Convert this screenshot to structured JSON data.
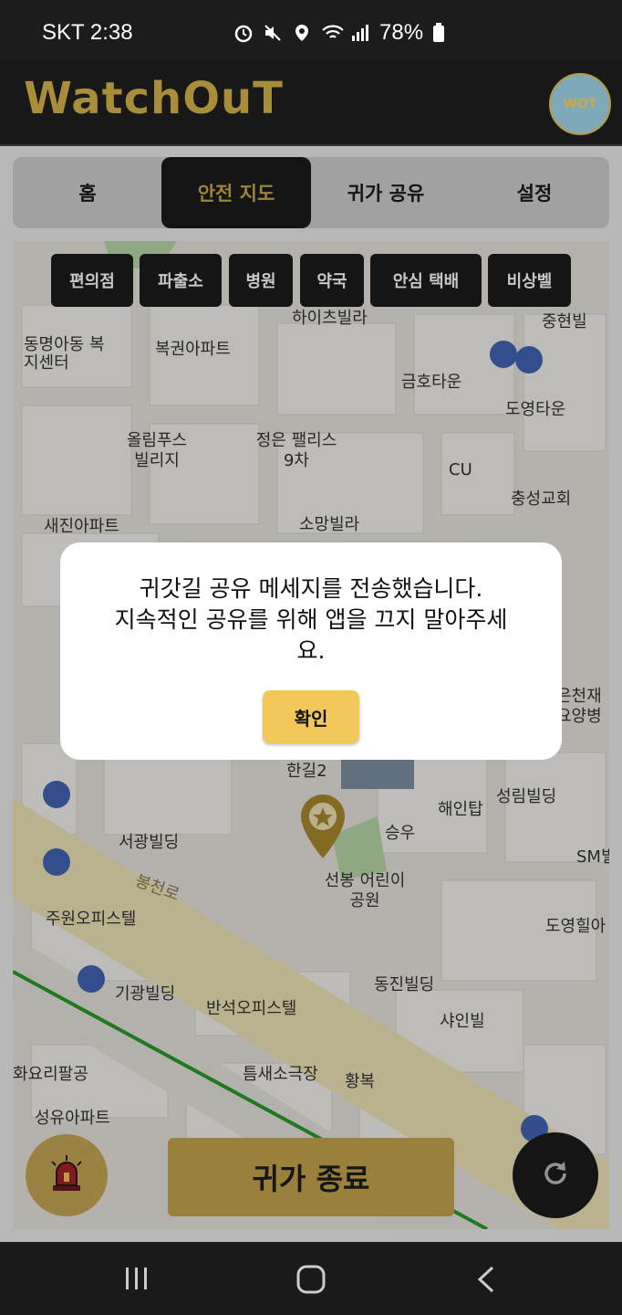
{
  "status_bar": {
    "carrier_time": "SKT 2:38",
    "battery": "78%"
  },
  "app": {
    "title": "WatchOuT",
    "avatar_text": "WOT"
  },
  "tabs": [
    {
      "label": "홈"
    },
    {
      "label": "안전 지도"
    },
    {
      "label": "귀가 공유"
    },
    {
      "label": "설정"
    }
  ],
  "filters": [
    "편의점",
    "파출소",
    "병원",
    "약국",
    "안심 택배",
    "비상벨"
  ],
  "map_labels": [
    "하이츠빌라",
    "중현빌",
    "동명아동 복지센터",
    "복권아파트",
    "금호타운",
    "도영타운",
    "올림푸스 빌리지",
    "정은 팰리스9차",
    "CU",
    "충성교회",
    "새진아파트",
    "소망빌라",
    "한길2",
    "해인탑",
    "성림빌딩",
    "승우",
    "서광빌딩",
    "선봉 어린이공원",
    "봉천로",
    "주원오피스텔",
    "도영힐아",
    "기광빌딩",
    "동진빌딩",
    "반석오피스텔",
    "샤인빌",
    "화요리팔공",
    "틈새소극장",
    "황복",
    "성유아파트",
    "은천재 요양병",
    "SM빌"
  ],
  "dialog": {
    "message_line1": "귀갓길 공유 메세지를 전송했습니다.",
    "message_line2": "지속적인 공유를 위해 앱을 끄지 말아주세",
    "message_line3": "요.",
    "confirm_label": "확인"
  },
  "actions": {
    "end_label": "귀가 종료"
  },
  "colors": {
    "accent_gold": "#c4a54c",
    "dark": "#1a1a1a",
    "confirm_yellow": "#f2c85a"
  },
  "icons": {
    "emergency": "siren-icon",
    "refresh": "refresh-icon",
    "location": "location-pin-icon"
  }
}
